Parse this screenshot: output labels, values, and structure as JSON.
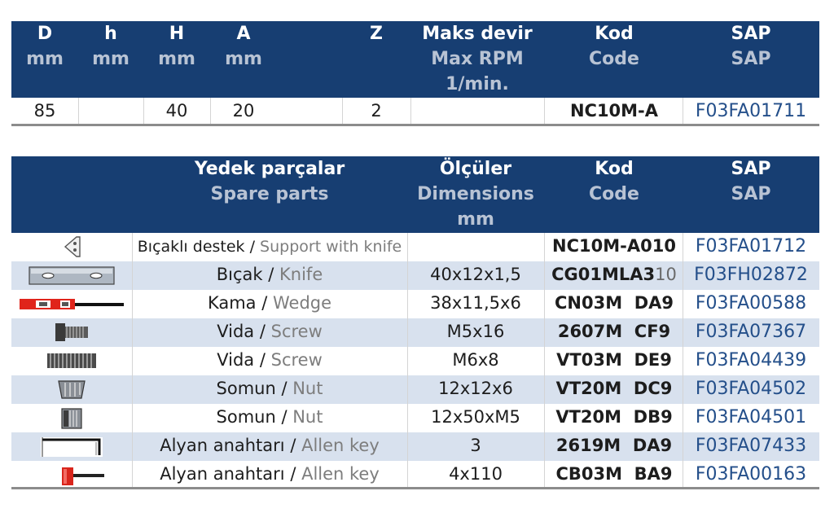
{
  "table1": {
    "headers": [
      {
        "tr": "D",
        "en": "mm"
      },
      {
        "tr": "h",
        "en": "mm"
      },
      {
        "tr": "H",
        "en": "mm"
      },
      {
        "tr": "A",
        "en": "mm"
      },
      {
        "tr": "Z",
        "en": ""
      },
      {
        "tr": "Maks devir",
        "en": "Max RPM",
        "en2": "1/min."
      },
      {
        "tr": "Kod",
        "en": "Code"
      },
      {
        "tr": "SAP",
        "en": "SAP"
      }
    ],
    "row": {
      "D": "85",
      "h": "",
      "H": "40",
      "A": "20",
      "Z": "2",
      "rpm": "",
      "kod": "NC10M-A",
      "sap": "F03FA01711"
    }
  },
  "table2": {
    "headers": {
      "parts": {
        "tr": "Yedek parçalar",
        "en": "Spare parts"
      },
      "dims": {
        "tr": "Ölçüler",
        "en": "Dimensions",
        "en2": "mm"
      },
      "kod": {
        "tr": "Kod",
        "en": "Code"
      },
      "sap": {
        "tr": "SAP",
        "en": "SAP"
      }
    },
    "rows": [
      {
        "icon": "support-with-knife-icon",
        "tr": "Bıçaklı destek",
        "sep": " / ",
        "en": "Support with knife",
        "dim": "",
        "kod": "NC10M-A010",
        "kod_suffix": "",
        "sap": "F03FA01712"
      },
      {
        "icon": "knife-icon",
        "tr": "Bıçak",
        "sep": " / ",
        "en": "Knife",
        "dim": "40x12x1,5",
        "kod": "CG01MLA3",
        "kod_suffix": "10",
        "sap": "F03FH02872"
      },
      {
        "icon": "wedge-icon",
        "tr": "Kama",
        "sep": " / ",
        "en": "Wedge",
        "dim": "38x11,5x6",
        "kod": "CN03M  DA9",
        "kod_suffix": "",
        "sap": "F03FA00588"
      },
      {
        "icon": "screw-icon",
        "tr": "Vida",
        "sep": " / ",
        "en": "Screw",
        "dim": "M5x16",
        "kod": "2607M  CF9",
        "kod_suffix": "",
        "sap": "F03FA07367"
      },
      {
        "icon": "screw-icon",
        "tr": "Vida",
        "sep": " / ",
        "en": "Screw",
        "dim": "M6x8",
        "kod": "VT03M  DE9",
        "kod_suffix": "",
        "sap": "F03FA04439"
      },
      {
        "icon": "nut-icon",
        "tr": "Somun",
        "sep": " / ",
        "en": "Nut",
        "dim": "12x12x6",
        "kod": "VT20M  DC9",
        "kod_suffix": "",
        "sap": "F03FA04502"
      },
      {
        "icon": "nut-icon",
        "tr": "Somun",
        "sep": " / ",
        "en": "Nut",
        "dim": "12x50xM5",
        "kod": "VT20M  DB9",
        "kod_suffix": "",
        "sap": "F03FA04501"
      },
      {
        "icon": "allen-key-icon",
        "tr": "Alyan anahtarı",
        "sep": " / ",
        "en": "Allen key",
        "dim": "3",
        "kod": "2619M  DA9",
        "kod_suffix": "",
        "sap": "F03FA07433"
      },
      {
        "icon": "allen-key-t-handle-icon",
        "tr": "Alyan anahtarı",
        "sep": " / ",
        "en": "Allen key",
        "dim": "4x110",
        "kod": "CB03M  BA9",
        "kod_suffix": "",
        "sap": "F03FA00163"
      }
    ]
  }
}
